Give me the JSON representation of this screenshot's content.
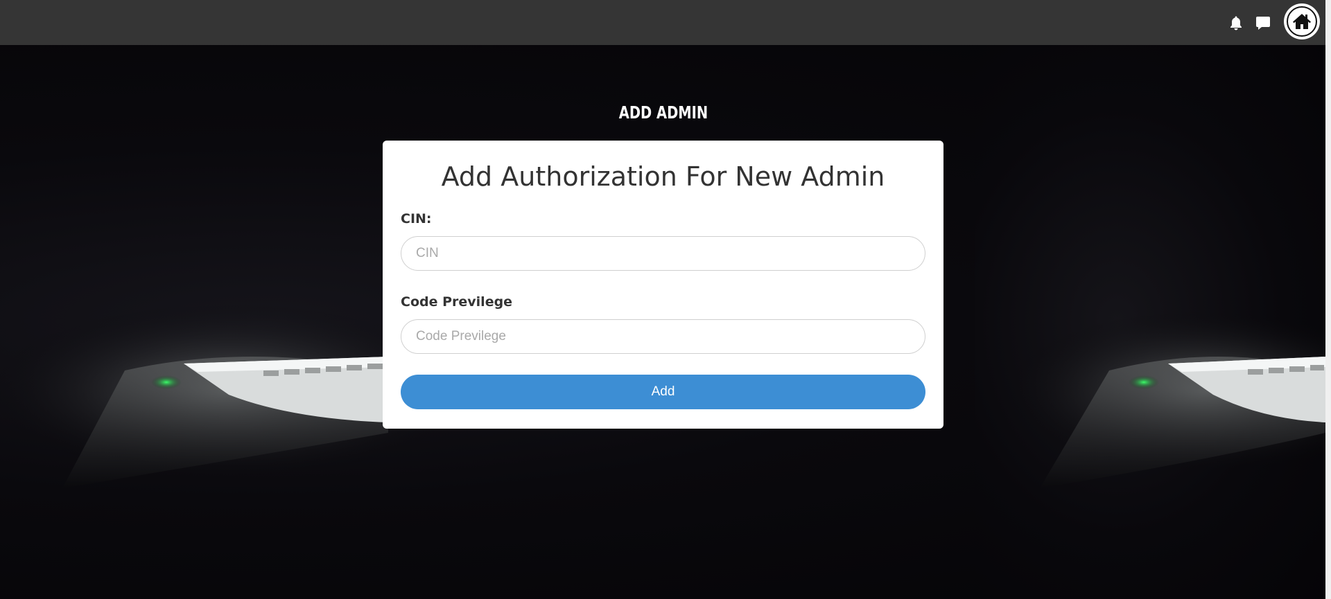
{
  "topbar": {
    "icons": [
      "bell-icon",
      "chat-icon",
      "home-icon"
    ]
  },
  "page": {
    "heading": "ADD ADMIN"
  },
  "form": {
    "title": "Add Authorization For New Admin",
    "cin_label": "CIN:",
    "cin_placeholder": "CIN",
    "cin_value": "",
    "code_label": "Code Previlege",
    "code_placeholder": "Code Previlege",
    "code_value": "",
    "submit_label": "Add"
  },
  "colors": {
    "topbar": "#353535",
    "button": "#3d8ed4",
    "card": "#ffffff",
    "heading_text": "#ffffff"
  }
}
